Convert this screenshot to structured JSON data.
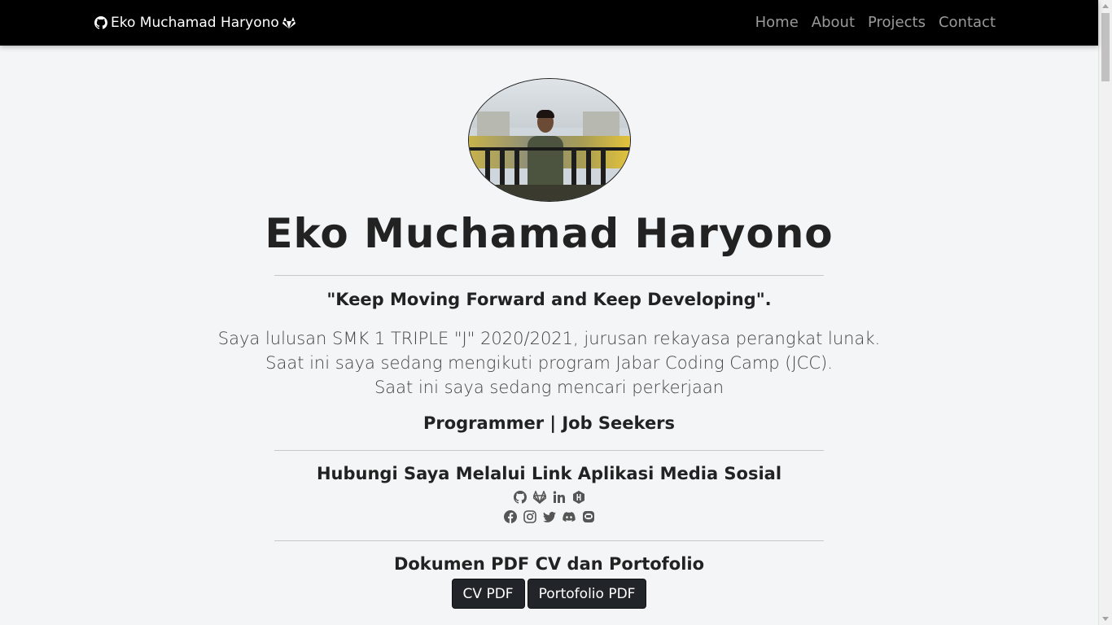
{
  "nav": {
    "brand": "Eko Muchamad Haryono",
    "brand_icons": [
      "github-icon",
      "gitlab-icon"
    ],
    "links": [
      "Home",
      "About",
      "Projects",
      "Contact"
    ]
  },
  "profile": {
    "name": "Eko Muchamad Haryono",
    "quote": "\"Keep Moving Forward and Keep Developing\".",
    "bio": [
      "Saya lulusan SMK 1 TRIPLE \"J\" 2020/2021, jurusan rekayasa perangkat lunak.",
      "Saat ini saya sedang mengikuti program Jabar Coding Camp (JCC).",
      "Saat ini saya sedang mencari perkerjaan"
    ],
    "role": "Programmer | Job Seekers"
  },
  "contact": {
    "title": "Hubungi Saya Melalui Link Aplikasi Media Sosial",
    "row1_icons": [
      "github-icon",
      "gitlab-icon",
      "linkedin-icon",
      "hackerrank-icon"
    ],
    "row2_icons": [
      "facebook-icon",
      "instagram-icon",
      "twitter-icon",
      "discord-icon",
      "line-icon"
    ]
  },
  "docs": {
    "title": "Dokumen PDF CV dan Portofolio",
    "cv_label": "CV PDF",
    "portfolio_label": "Portofolio PDF"
  },
  "colors": {
    "navbar": "#000000",
    "background": "#f4f5f7",
    "button": "#212529",
    "nav_link": "#9a9a9a"
  }
}
